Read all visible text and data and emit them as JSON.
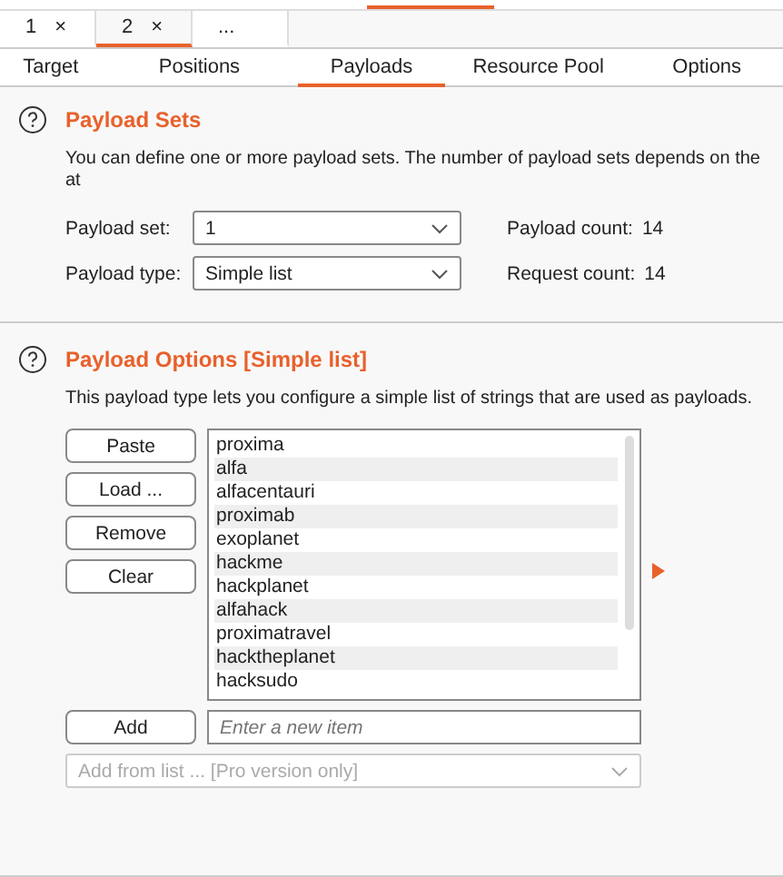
{
  "instance_tabs": [
    {
      "label": "1",
      "close": "×",
      "selected": false
    },
    {
      "label": "2",
      "close": "×",
      "selected": true
    },
    {
      "label": "...",
      "selected": false
    }
  ],
  "tabs": [
    {
      "label": "Target",
      "selected": false
    },
    {
      "label": "Positions",
      "selected": false
    },
    {
      "label": "Payloads",
      "selected": true
    },
    {
      "label": "Resource Pool",
      "selected": false
    },
    {
      "label": "Options",
      "selected": false
    }
  ],
  "payload_sets": {
    "title": "Payload Sets",
    "description": "You can define one or more payload sets. The number of payload sets depends on the at",
    "fields": [
      {
        "label": "Payload set:",
        "value": "1",
        "count_label": "Payload count:",
        "count": "14"
      },
      {
        "label": "Payload type:",
        "value": "Simple list",
        "count_label": "Request count:",
        "count": "14"
      }
    ]
  },
  "payload_options": {
    "title": "Payload Options [Simple list]",
    "description": "This payload type lets you configure a simple list of strings that are used as payloads.",
    "buttons": [
      "Paste",
      "Load ...",
      "Remove",
      "Clear"
    ],
    "items": [
      "proxima",
      "alfa",
      "alfacentauri",
      "proximab",
      "exoplanet",
      "hackme",
      "hackplanet",
      "alfahack",
      "proximatravel",
      "hacktheplanet",
      "hacksudo"
    ],
    "add_button": "Add",
    "new_item": {
      "placeholder": "Enter a new item"
    },
    "add_from_list": {
      "value": "Add from list ... [Pro version only]",
      "disabled": true
    }
  }
}
